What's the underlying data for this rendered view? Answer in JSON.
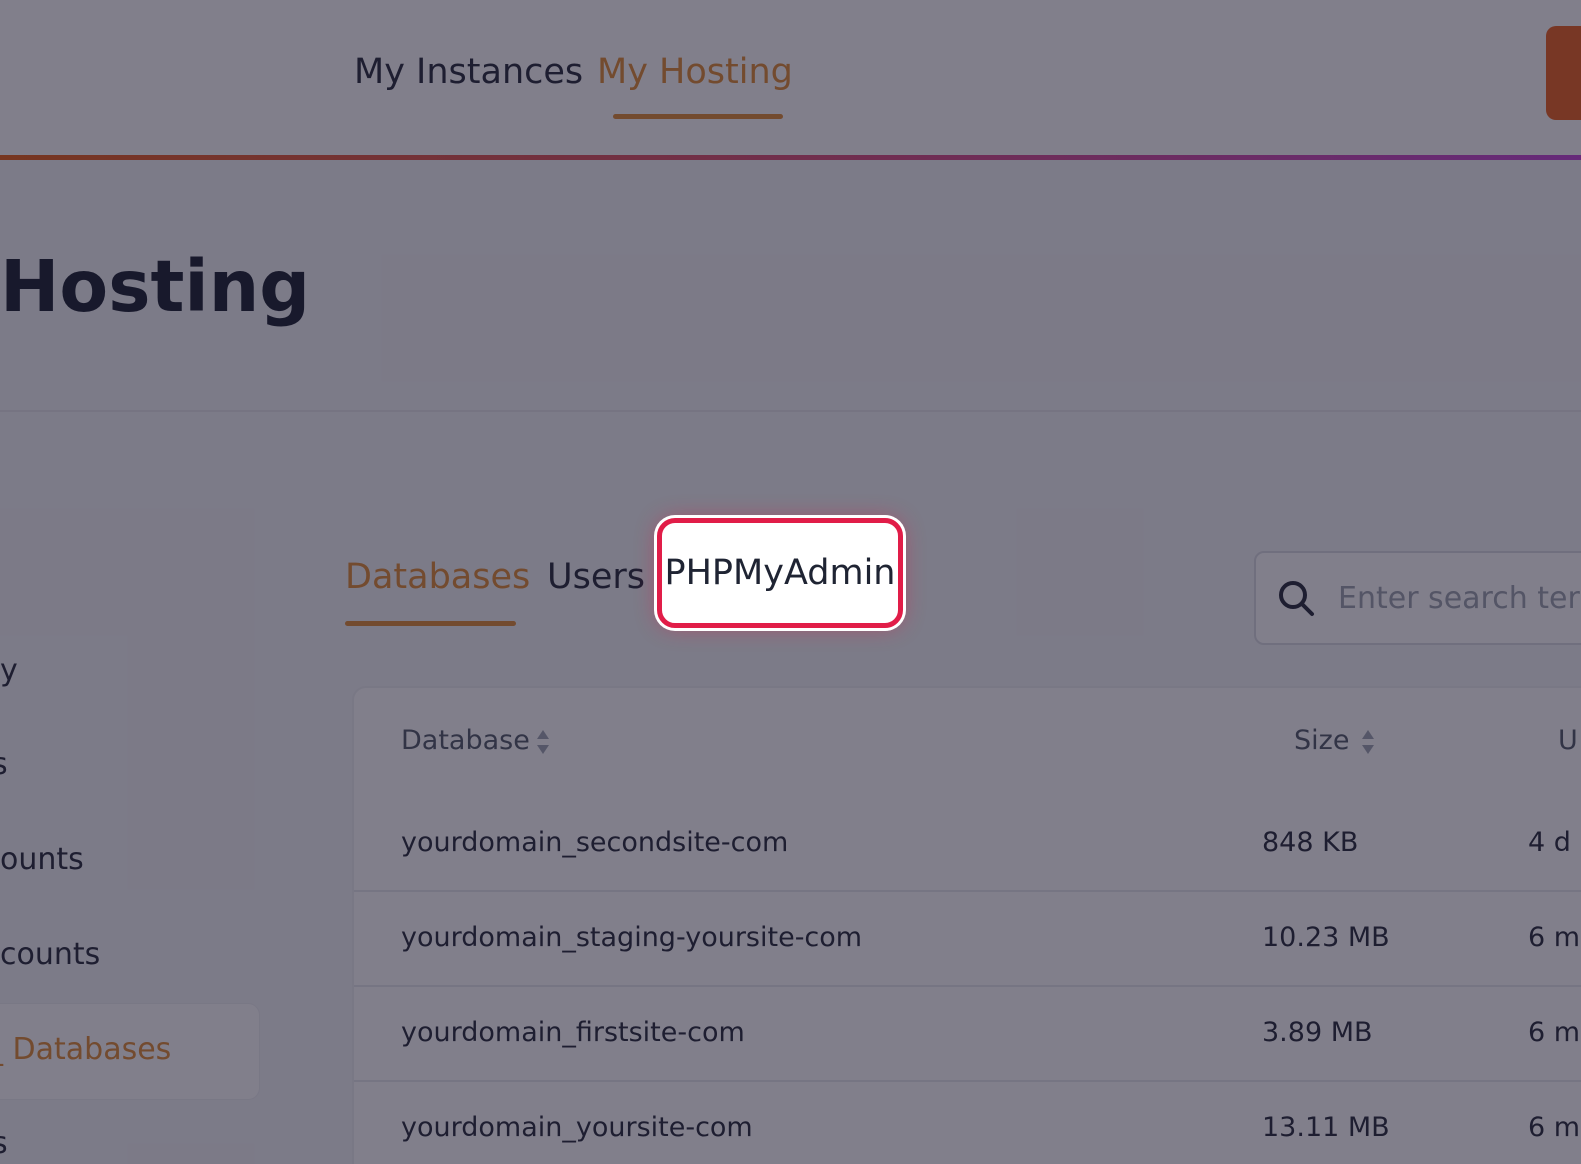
{
  "header": {
    "nav": [
      {
        "label": "My Instances",
        "active": false
      },
      {
        "label": "My Hosting",
        "active": true
      }
    ]
  },
  "page": {
    "title": "Hosting"
  },
  "sidebar": {
    "items": [
      {
        "label": "y",
        "active": false
      },
      {
        "label": "s",
        "active": false
      },
      {
        "label": "ounts",
        "active": false
      },
      {
        "label": "counts",
        "active": false
      },
      {
        "label": "_ Databases",
        "active": true
      },
      {
        "label": "s",
        "active": false
      }
    ]
  },
  "tabs": [
    {
      "label": "Databases",
      "active": true
    },
    {
      "label": "Users",
      "active": false
    },
    {
      "label": "PHPMyAdmin",
      "active": false,
      "highlighted": true
    }
  ],
  "search": {
    "placeholder": "Enter search terms"
  },
  "table": {
    "columns": [
      "Database",
      "Size",
      "U"
    ],
    "rows": [
      {
        "name": "yourdomain_secondsite-com",
        "size": "848 KB",
        "updated": "4 d"
      },
      {
        "name": "yourdomain_staging-yoursite-com",
        "size": "10.23 MB",
        "updated": "6 m"
      },
      {
        "name": "yourdomain_firstsite-com",
        "size": "3.89 MB",
        "updated": "6 m"
      },
      {
        "name": "yourdomain_yoursite-com",
        "size": "13.11 MB",
        "updated": "6 m"
      }
    ]
  },
  "colors": {
    "accent": "#e0882e",
    "highlight": "#e11d48",
    "text": "#1f2433"
  }
}
